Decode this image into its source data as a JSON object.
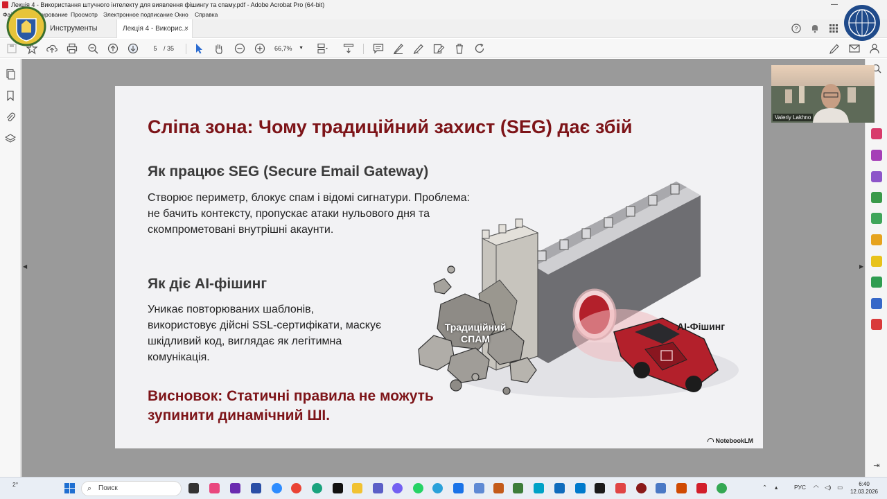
{
  "window": {
    "title": "Лекція 4 - Використання штучного інтелекту для виявлення фішингу та спаму.pdf - Adobe Acrobat Pro (64-bit)",
    "minimize": "—",
    "close": "✕"
  },
  "menu": {
    "items": [
      "Файл",
      "Редактирование",
      "Просмотр",
      "Электронное подписание",
      "Окно",
      "Справка"
    ]
  },
  "tabs": {
    "tools": "Инструменты",
    "doc": "Лекція 4 - Викорис...",
    "close": "×"
  },
  "toolbar": {
    "page_current": "5",
    "page_total": "/ 35",
    "zoom": "66,7%"
  },
  "slide": {
    "title": "Сліпа зона: Чому традиційний захист (SEG) дає збій",
    "section1_heading": "Як працює SEG (Secure Email Gateway)",
    "section1_text": "Створює периметр, блокує спам і відомі сигнатури. Проблема: не бачить контексту, пропускає атаки нульового дня та скомпрометовані внутрішні акаунти.",
    "section2_heading": "Як діє AI-фішинг",
    "section2_text": "Уникає повторюваних шаблонів, використовує дійсні SSL-сертифікати, маскує шкідливий код, виглядає як легітимна комунікація.",
    "conclusion": "Висновок: Статичні правила не можуть зупинити динамічний ШІ.",
    "label_spam_1": "Традиційний",
    "label_spam_2": "СПАМ",
    "label_ai": "AI-Фішинг",
    "watermark": "NotebookLM"
  },
  "webcam": {
    "name": "Valeriy Lakhno"
  },
  "taskbar": {
    "search": "Поиск",
    "lang": "РУС",
    "time": "6:40",
    "date": "12.03.2026",
    "weather": "2°"
  },
  "colors": {
    "accent_red": "#7d1418",
    "slide_bg": "#f2f2f4",
    "doc_bg": "#9a9a9a"
  }
}
